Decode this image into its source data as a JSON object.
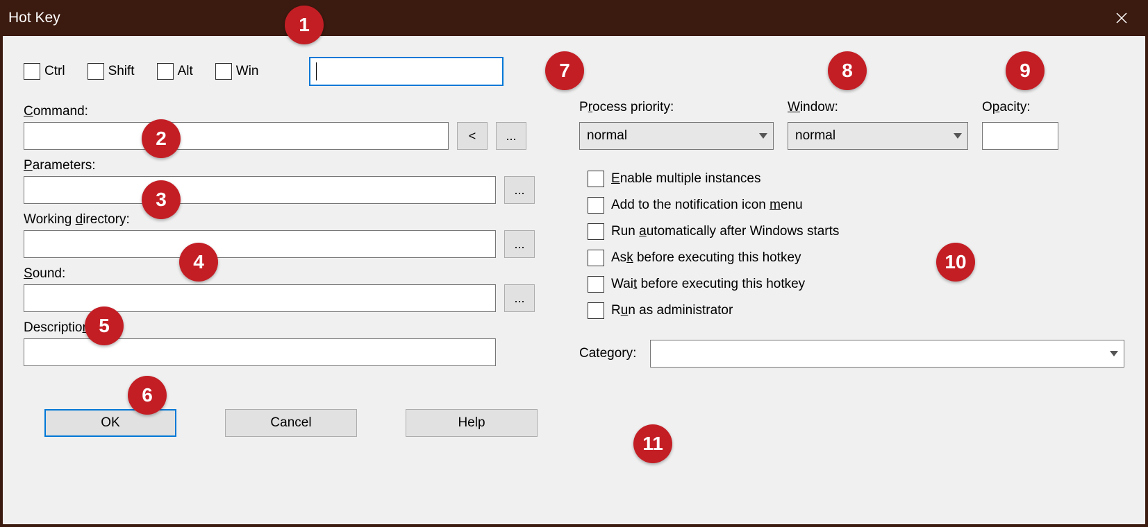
{
  "title": "Hot Key",
  "modifiers": {
    "ctrl": "Ctrl",
    "shift": "Shift",
    "alt": "Alt",
    "win": "Win"
  },
  "hotkey_value": "",
  "left_fields": {
    "command": {
      "label_pre": "",
      "label_u": "C",
      "label_post": "ommand:",
      "value": ""
    },
    "parameters": {
      "label_pre": "",
      "label_u": "P",
      "label_post": "arameters:",
      "value": ""
    },
    "working_dir": {
      "label_pre": "Working ",
      "label_u": "d",
      "label_post": "irectory:",
      "value": ""
    },
    "sound": {
      "label_pre": "",
      "label_u": "S",
      "label_post": "ound:",
      "value": ""
    },
    "description": {
      "label_pre": "Descriptio",
      "label_u": "n",
      "label_post": ":",
      "value": ""
    }
  },
  "browse_btn": "...",
  "back_btn": "<",
  "buttons": {
    "ok": "OK",
    "cancel": "Cancel",
    "help": "Help"
  },
  "right_top": {
    "priority": {
      "label_pre": "P",
      "label_u": "r",
      "label_post": "ocess priority:",
      "value": "normal"
    },
    "window": {
      "label_pre": "",
      "label_u": "W",
      "label_post": "indow:",
      "value": "normal"
    },
    "opacity": {
      "label_pre": "O",
      "label_u": "p",
      "label_post": "acity:",
      "value": ""
    }
  },
  "options": {
    "multi": {
      "pre": "",
      "u": "E",
      "post": "nable multiple instances"
    },
    "notify": {
      "pre": "Add to the notification icon ",
      "u": "m",
      "post": "enu"
    },
    "autorun": {
      "pre": "Run ",
      "u": "a",
      "post": "utomatically after Windows starts"
    },
    "ask": {
      "pre": "As",
      "u": "k",
      "post": " before executing this hotkey"
    },
    "wait": {
      "pre": "Wai",
      "u": "t",
      "post": " before executing this hotkey"
    },
    "admin": {
      "pre": "R",
      "u": "u",
      "post": "n as administrator"
    }
  },
  "category": {
    "label": "Category:",
    "value": ""
  },
  "badges": [
    "1",
    "2",
    "3",
    "4",
    "5",
    "6",
    "7",
    "8",
    "9",
    "10",
    "11"
  ]
}
